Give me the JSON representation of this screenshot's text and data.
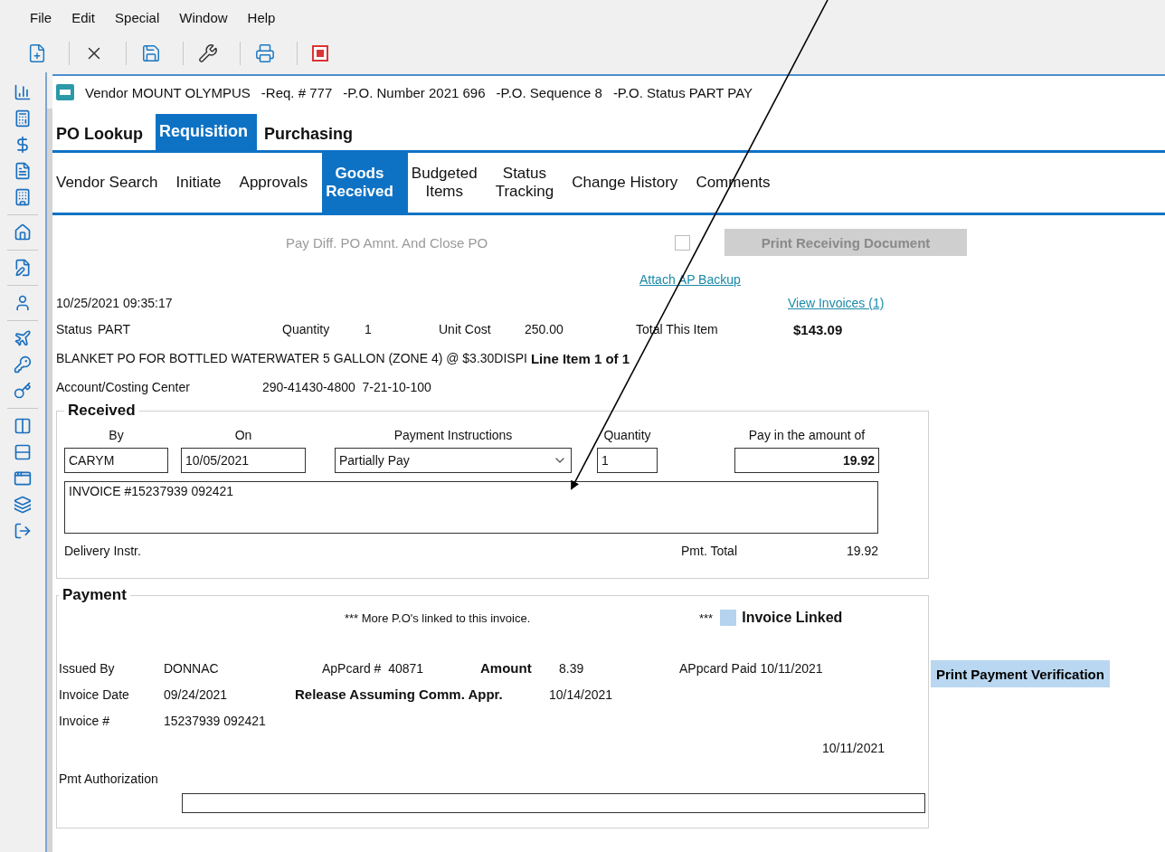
{
  "menu": [
    "File",
    "Edit",
    "Special",
    "Window",
    "Help"
  ],
  "window": {
    "title_parts": [
      "Vendor MOUNT OLYMPUS",
      "-Req. # 777",
      "-P.O. Number 2021 696",
      "-P.O. Sequence 8",
      "-P.O. Status PART PAY"
    ]
  },
  "tabs": [
    {
      "label": "PO Lookup",
      "selected": false
    },
    {
      "label": "Requisition",
      "selected": true
    },
    {
      "label": "Purchasing",
      "selected": false
    }
  ],
  "subtabs": [
    {
      "label": "Vendor Search",
      "selected": false
    },
    {
      "label": "Initiate",
      "selected": false
    },
    {
      "label": "Approvals",
      "selected": false
    },
    {
      "label": "Goods\nReceived",
      "selected": true
    },
    {
      "label": "Budgeted\nItems",
      "selected": false
    },
    {
      "label": "Status\nTracking",
      "selected": false
    },
    {
      "label": "Change History",
      "selected": false
    },
    {
      "label": "Comments",
      "selected": false
    }
  ],
  "close_option": {
    "label": "Pay Diff. PO Amnt. And Close PO",
    "disabled": true,
    "checked": false
  },
  "print_receiving_button": {
    "label": "Print Receiving Document",
    "disabled": true
  },
  "attach_link": "Attach AP Backup",
  "view_invoices_link": "View Invoices (1)",
  "timestamp": "10/25/2021 09:35:17",
  "item": {
    "status_label": "Status",
    "status": "PART",
    "quantity_label": "Quantity",
    "quantity": "1",
    "unit_cost_label": "Unit Cost",
    "unit_cost": "250.00",
    "total_label": "Total This Item",
    "total": "$143.09",
    "description": "BLANKET PO FOR BOTTLED WATERWATER 5 GALLON (ZONE 4) @ $3.30DISPI",
    "line_item": "Line Item 1 of 1",
    "account_label": "Account/Costing Center",
    "account": "290-41430-4800  7-21-10-100"
  },
  "received": {
    "title": "Received",
    "headers": [
      "By",
      "On",
      "Payment Instructions",
      "Quantity",
      "Pay in the amount of"
    ],
    "by": "CARYM",
    "on": "10/05/2021",
    "payment_instructions": "Partially Pay",
    "quantity": "1",
    "amount": "19.92",
    "notes": "INVOICE #15237939 092421",
    "delivery_label": "Delivery Instr.",
    "pmt_total_label": "Pmt. Total",
    "pmt_total": "19.92"
  },
  "payment": {
    "title": "Payment",
    "linked_note": "*** More P.O's linked to this invoice.",
    "linked_marker": "***",
    "linked_label": "Invoice Linked",
    "issued_by_label": "Issued By",
    "issued_by": "DONNAC",
    "apcard": "ApPcard #  40871",
    "amount_label": "Amount",
    "amount": "8.39",
    "apcard_paid": "APpcard Paid 10/11/2021",
    "invoice_date_label": "Invoice Date",
    "invoice_date": "09/24/2021",
    "release_label": "Release Assuming Comm. Appr.",
    "release_date": "10/14/2021",
    "invoice_no_label": "Invoice #",
    "invoice_no": "15237939 092421",
    "paid_date": "10/11/2021",
    "authorization_label": "Pmt Authorization"
  },
  "print_payment_button": "Print Payment Verification"
}
